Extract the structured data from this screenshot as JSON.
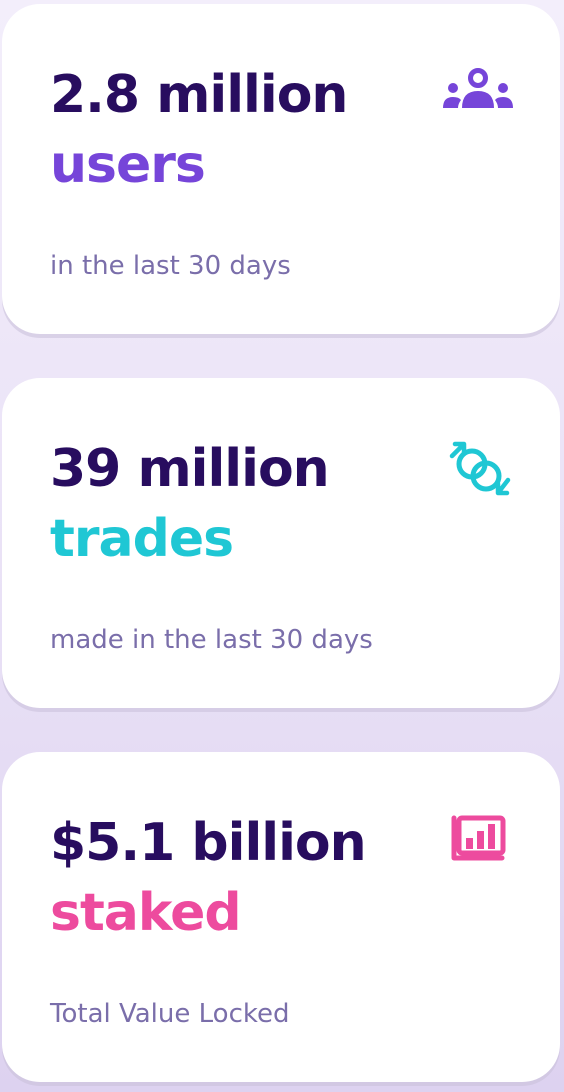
{
  "stats": [
    {
      "value": "2.8 million",
      "noun": "users",
      "caption": "in the last 30 days",
      "icon": "users-icon",
      "accent": "#7645d9"
    },
    {
      "value": "39 million",
      "noun": "trades",
      "caption": "made in the last 30 days",
      "icon": "trade-swap-icon",
      "accent": "#1fc7d4"
    },
    {
      "value": "$5.1 billion",
      "noun": "staked",
      "caption": "Total Value Locked",
      "icon": "bar-chart-icon",
      "accent": "#ed4b9e"
    }
  ],
  "colors": {
    "heading": "#280d5f",
    "caption": "#7a6eaa",
    "background": "#ece4f8"
  }
}
